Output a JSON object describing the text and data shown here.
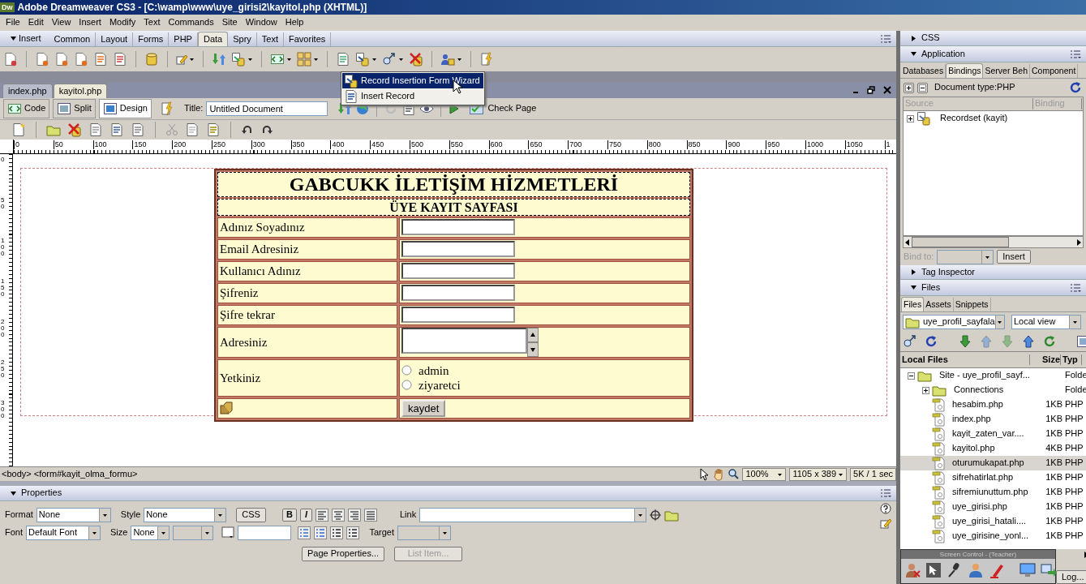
{
  "window": {
    "app_badge": "Dw",
    "title": "Adobe Dreamweaver CS3 - [C:\\wamp\\www\\uye_girisi2\\kayitol.php (XHTML)]"
  },
  "menu": [
    "File",
    "Edit",
    "View",
    "Insert",
    "Modify",
    "Text",
    "Commands",
    "Site",
    "Window",
    "Help"
  ],
  "insert_bar": {
    "title": "Insert",
    "expanded": true,
    "tabs": [
      {
        "label": "Common",
        "selected": false
      },
      {
        "label": "Layout",
        "selected": false
      },
      {
        "label": "Forms",
        "selected": false
      },
      {
        "label": "PHP",
        "selected": false
      },
      {
        "label": "Data",
        "selected": true
      },
      {
        "label": "Spry",
        "selected": false
      },
      {
        "label": "Text",
        "selected": false
      },
      {
        "label": "Favorites",
        "selected": false
      }
    ]
  },
  "insert_menu": {
    "items": [
      {
        "label": "Record Insertion Form Wizard",
        "selected": true
      },
      {
        "label": "Insert Record",
        "selected": false
      }
    ]
  },
  "document_tabs": [
    {
      "label": "index.php",
      "selected": false
    },
    {
      "label": "kayitol.php",
      "selected": true
    }
  ],
  "document_toolbar": {
    "views": [
      {
        "label": "Code",
        "selected": false
      },
      {
        "label": "Split",
        "selected": false
      },
      {
        "label": "Design",
        "selected": true
      }
    ],
    "title_label": "Title:",
    "title_value": "Untitled Document",
    "check_page": "Check Page"
  },
  "ruler": {
    "horizontal": [
      "0",
      "50",
      "100",
      "150",
      "200",
      "250",
      "300",
      "350",
      "400",
      "450",
      "500",
      "550",
      "600",
      "650",
      "700",
      "750",
      "800",
      "850",
      "900",
      "950",
      "1000",
      "1050",
      "1"
    ],
    "vertical": [
      "0",
      "50",
      "100",
      "150",
      "200",
      "250",
      "300"
    ]
  },
  "form": {
    "heading": "GABCUKK İLETİŞİM HİZMETLERİ",
    "subheading": "ÜYE KAYIT SAYFASI",
    "rows": [
      {
        "kind": "text",
        "label": "Adınız Soyadınız"
      },
      {
        "kind": "text",
        "label": "Email Adresiniz"
      },
      {
        "kind": "text",
        "label": "Kullanıcı Adınız"
      },
      {
        "kind": "text",
        "label": "Şifreniz"
      },
      {
        "kind": "text",
        "label": "Şifre tekrar"
      },
      {
        "kind": "textarea",
        "label": "Adresiniz"
      },
      {
        "kind": "radio",
        "label": "Yetkiniz",
        "options": [
          {
            "label": "admin",
            "checked": false
          },
          {
            "label": "ziyaretci",
            "checked": false
          }
        ]
      },
      {
        "kind": "submit",
        "button": "kaydet"
      }
    ]
  },
  "status_bar": {
    "tag_path": "<body> <form#kayit_olma_formu>",
    "zoom": "100%",
    "window_size": "1105 x 389",
    "download": "5K / 1 sec"
  },
  "properties": {
    "title": "Properties",
    "expanded": true,
    "format_label": "Format",
    "format": "None",
    "style_label": "Style",
    "style": "None",
    "css_button": "CSS",
    "bold_button": "B",
    "italic_button": "I",
    "link_label": "Link",
    "font_label": "Font",
    "font": "Default Font",
    "size_label": "Size",
    "size": "None",
    "target_label": "Target",
    "page_properties_button": "Page Properties...",
    "list_item_button": {
      "label": "List Item...",
      "disabled": true
    }
  },
  "css_panel": {
    "title": "CSS",
    "expanded": false
  },
  "application_panel": {
    "title": "Application",
    "expanded": true,
    "tabs": [
      {
        "label": "Databases",
        "selected": false
      },
      {
        "label": "Bindings",
        "selected": true
      },
      {
        "label": "Server Beh",
        "selected": false
      },
      {
        "label": "Component",
        "selected": false
      }
    ],
    "document_type": "Document type:PHP",
    "columns": [
      "Source",
      "Binding"
    ],
    "items": [
      {
        "label": "Recordset (kayit)",
        "expanded": false
      }
    ],
    "bind_to_label": "Bind to:",
    "insert_button": "Insert"
  },
  "tag_inspector_panel": {
    "title": "Tag Inspector",
    "expanded": false
  },
  "files_panel": {
    "title": "Files",
    "expanded": true,
    "tabs": [
      {
        "label": "Files",
        "selected": true
      },
      {
        "label": "Assets",
        "selected": false
      },
      {
        "label": "Snippets",
        "selected": false
      }
    ],
    "site": "uye_profil_sayfala",
    "view": "Local view",
    "columns": [
      "Local Files",
      "Size",
      "Typ"
    ],
    "tree": [
      {
        "kind": "site",
        "name": "Site - uye_profil_sayf...",
        "type": "Folde",
        "expanded": true,
        "selected": false,
        "children": [
          {
            "kind": "folder",
            "name": "Connections",
            "type": "Folde",
            "expanded": false,
            "selected": false
          },
          {
            "kind": "file",
            "name": "hesabim.php",
            "size": "1KB",
            "type": "PHP",
            "selected": false
          },
          {
            "kind": "file",
            "name": "index.php",
            "size": "1KB",
            "type": "PHP",
            "selected": false
          },
          {
            "kind": "file",
            "name": "kayit_zaten_var....",
            "size": "1KB",
            "type": "PHP",
            "selected": false
          },
          {
            "kind": "file",
            "name": "kayitol.php",
            "size": "4KB",
            "type": "PHP",
            "selected": false
          },
          {
            "kind": "file",
            "name": "oturumukapat.php",
            "size": "1KB",
            "type": "PHP",
            "selected": true
          },
          {
            "kind": "file",
            "name": "sifrehatirlat.php",
            "size": "1KB",
            "type": "PHP",
            "selected": false
          },
          {
            "kind": "file",
            "name": "sifremiunuttum.php",
            "size": "1KB",
            "type": "PHP",
            "selected": false
          },
          {
            "kind": "file",
            "name": "uye_girisi.php",
            "size": "1KB",
            "type": "PHP",
            "selected": false
          },
          {
            "kind": "file",
            "name": "uye_girisi_hatali....",
            "size": "1KB",
            "type": "PHP",
            "selected": false
          },
          {
            "kind": "file",
            "name": "uye_girisine_yonl...",
            "size": "1KB",
            "type": "PHP",
            "selected": false
          }
        ]
      }
    ]
  },
  "screen_control": {
    "title": "Screen Control - (Teacher)",
    "log_button": "Log..."
  }
}
